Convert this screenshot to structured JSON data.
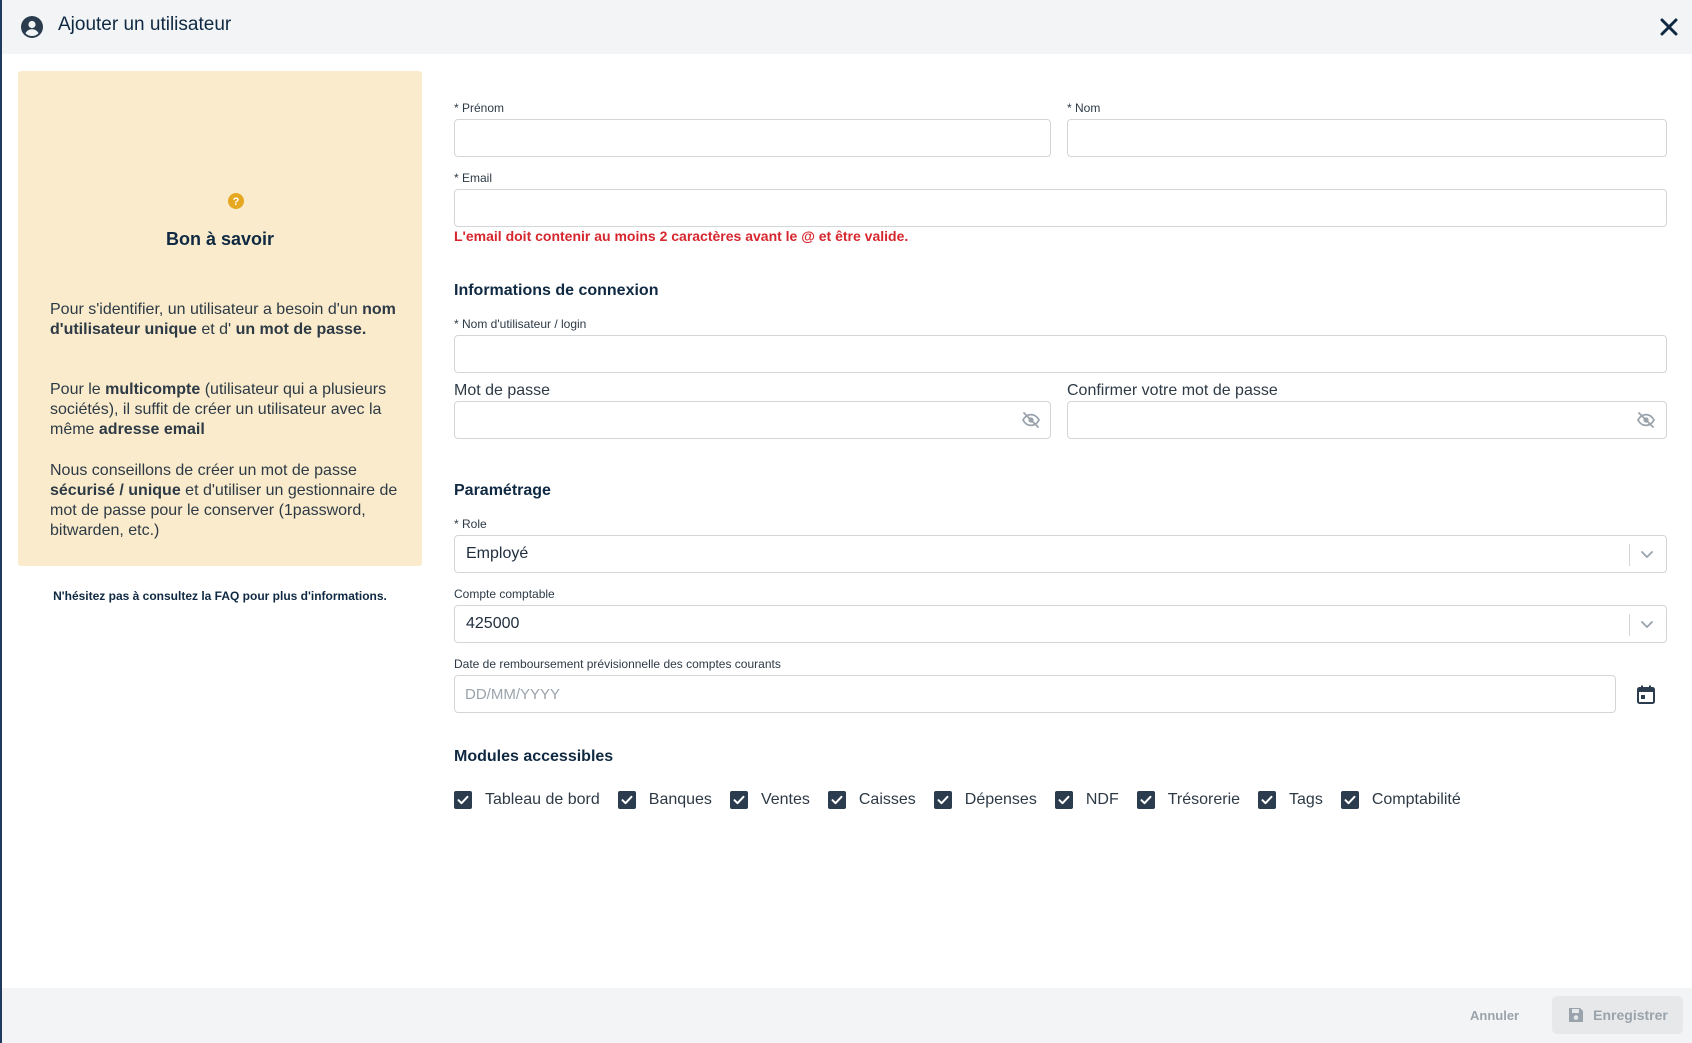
{
  "dialog": {
    "title": "Ajouter un utilisateur",
    "close_icon": "close-icon"
  },
  "info": {
    "title": "Bon à savoir",
    "p1": [
      {
        "t": "Pour s'identifier, un utilisateur a besoin d'un ",
        "b": false
      },
      {
        "t": "nom d'utilisateur unique",
        "b": true
      },
      {
        "t": " et d' ",
        "b": false
      },
      {
        "t": "un mot de passe.",
        "b": true
      }
    ],
    "p2": [
      {
        "t": "Pour le ",
        "b": false
      },
      {
        "t": "multicompte",
        "b": true
      },
      {
        "t": " (utilisateur qui a plusieurs sociétés), il suffit de créer un utilisateur avec la même ",
        "b": false
      },
      {
        "t": "adresse email",
        "b": true
      }
    ],
    "p3": [
      {
        "t": "Nous conseillons de créer un mot de passe ",
        "b": false
      },
      {
        "t": "sécurisé / unique",
        "b": true
      },
      {
        "t": " et d'utiliser un gestionnaire de mot de passe pour le conserver (1password, bitwarden, etc.)",
        "b": false
      }
    ],
    "footer": "N'hésitez pas à consultez la FAQ pour plus d'informations."
  },
  "form": {
    "prenom_label": "* Prénom",
    "prenom_value": "",
    "nom_label": "* Nom",
    "nom_value": "",
    "email_label": "* Email",
    "email_value": "",
    "email_error": "L'email doit contenir au moins 2 caractères avant le @ et être valide.",
    "connexion_title": "Informations de connexion",
    "login_label": "* Nom d'utilisateur / login",
    "login_value": "",
    "password_label": "Mot de passe",
    "password_value": "",
    "confirm_label": "Confirmer votre mot de passe",
    "confirm_value": "",
    "param_title": "Paramétrage",
    "role_label": "* Role",
    "role_value": "Employé",
    "compte_label": "Compte comptable",
    "compte_value": "425000",
    "date_label": "Date de remboursement prévisionnelle des comptes courants",
    "date_placeholder": "DD/MM/YYYY",
    "date_value": "",
    "modules_title": "Modules accessibles",
    "modules": [
      {
        "label": "Tableau de bord",
        "checked": true
      },
      {
        "label": "Banques",
        "checked": true
      },
      {
        "label": "Ventes",
        "checked": true
      },
      {
        "label": "Caisses",
        "checked": true
      },
      {
        "label": "Dépenses",
        "checked": true
      },
      {
        "label": "NDF",
        "checked": true
      },
      {
        "label": "Trésorerie",
        "checked": true
      },
      {
        "label": "Tags",
        "checked": true
      },
      {
        "label": "Comptabilité",
        "checked": true
      }
    ]
  },
  "footer": {
    "cancel_label": "Annuler",
    "save_label": "Enregistrer"
  },
  "colors": {
    "info_bg": "#f9ebcb",
    "error": "#d6262e",
    "help_icon": "#e6a821",
    "checkbox": "#2b3c4e"
  }
}
